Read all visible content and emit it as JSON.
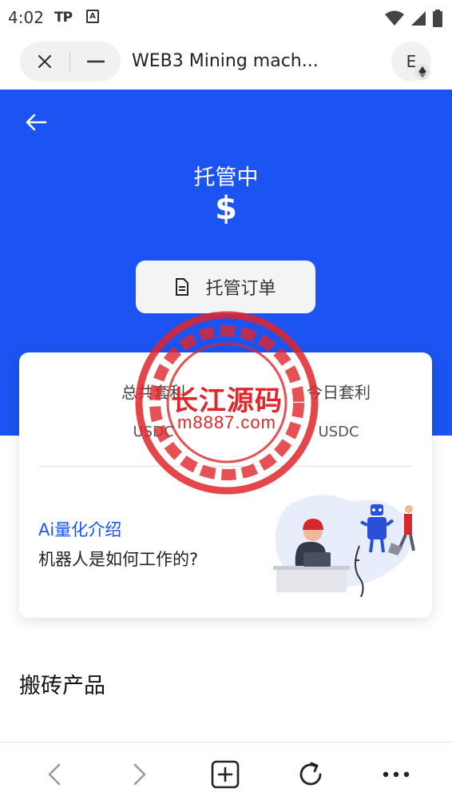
{
  "status_bar": {
    "time": "4:02",
    "app_label_1": "TP",
    "app_label_2": "A"
  },
  "browser": {
    "page_title": "WEB3 Mining mach...",
    "account_initial": "E",
    "close_icon": "close-icon",
    "minimize_icon": "minimize-icon"
  },
  "hero": {
    "title": "托管中",
    "amount": "$",
    "order_button_label": "托管订单",
    "background_color": "#1b54f2"
  },
  "card": {
    "stats": [
      {
        "label": "总共套利",
        "unit": "USDC"
      },
      {
        "label": "今日套利",
        "unit": "USDC"
      }
    ],
    "ai_title": "Ai量化介绍",
    "ai_subtitle": "机器人是如何工作的?"
  },
  "section": {
    "title": "搬砖产品"
  },
  "bottom_nav": {
    "items": [
      "back-icon",
      "forward-icon",
      "new-tab-icon",
      "refresh-icon",
      "more-icon"
    ]
  },
  "watermark": {
    "text": "长江源码",
    "url": "m8887.com",
    "color": "#e0262a"
  }
}
